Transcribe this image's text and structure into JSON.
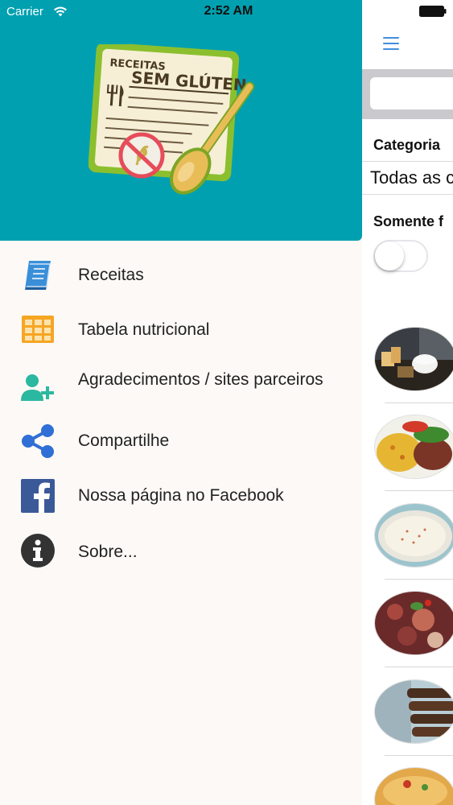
{
  "status_bar": {
    "carrier": "Carrier",
    "time": "2:52 AM"
  },
  "drawer": {
    "header_bg": "#00a0b0",
    "logo": {
      "line1": "RECEITAS",
      "line2": "SEM GLÚTEN"
    },
    "items": [
      {
        "label": "Receitas",
        "icon": "book-icon",
        "color": "#3b8fd9"
      },
      {
        "label": "Tabela nutricional",
        "icon": "grid-table-icon",
        "color": "#f5a623"
      },
      {
        "label": "Agradecimentos / sites parceiros",
        "icon": "add-user-icon",
        "color": "#2bb8a0"
      },
      {
        "label": "Compartilhe",
        "icon": "share-icon",
        "color": "#2f6fd6"
      },
      {
        "label": "Nossa página no Facebook",
        "icon": "facebook-icon",
        "color": "#3b5998"
      },
      {
        "label": "Sobre...",
        "icon": "info-icon",
        "color": "#333333"
      }
    ]
  },
  "main": {
    "category_label": "Categoria",
    "category_value": "Todas as c",
    "favorites_label": "Somente f",
    "favorites_toggle": false
  }
}
